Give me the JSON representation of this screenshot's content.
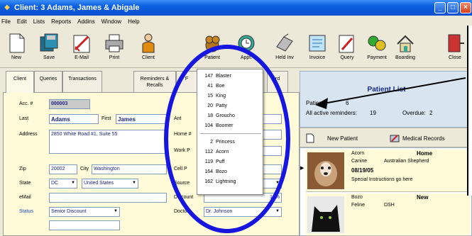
{
  "window": {
    "title": "Client: 3 Adams, James & Abigale",
    "menu": [
      "File",
      "Edit",
      "Lists",
      "Reports",
      "Addins",
      "Window",
      "Help"
    ]
  },
  "toolbar": {
    "items": [
      {
        "label": "New",
        "icon": "new-document-icon"
      },
      {
        "label": "Save",
        "icon": "save-icon"
      },
      {
        "label": "E-Mail",
        "icon": "email-icon"
      },
      {
        "label": "Print",
        "icon": "printer-icon"
      },
      {
        "label": "Client",
        "icon": "client-icon"
      },
      {
        "label": "Patient",
        "icon": "patient-icon"
      },
      {
        "label": "Appt.",
        "icon": "appointment-icon"
      },
      {
        "label": "Held Inv",
        "icon": "held-invoice-icon"
      },
      {
        "label": "Invoice",
        "icon": "invoice-icon"
      },
      {
        "label": "Query",
        "icon": "query-icon"
      },
      {
        "label": "Payment",
        "icon": "payment-icon"
      },
      {
        "label": "Boarding",
        "icon": "boarding-icon"
      },
      {
        "label": "Close",
        "icon": "close-icon"
      }
    ]
  },
  "tabs": [
    {
      "label": "Client"
    },
    {
      "label": "Queries"
    },
    {
      "label": "Transactions"
    },
    {
      "label": "Reminders & Recalls"
    },
    {
      "label": "F"
    },
    {
      "label": "rd"
    }
  ],
  "form": {
    "acct_label": "Acc. #",
    "acct_value": "000003",
    "last_label": "Last",
    "last_value": "Adams",
    "first_label": "First",
    "first_value": "James",
    "address_label": "Address",
    "address_value": "2850 White Road #1, Suite 55",
    "zip_label": "Zip",
    "zip_value": "20002",
    "city_label": "City",
    "city_value": "Washington",
    "state_label": "State",
    "state_value": "DC",
    "country_value": "United States",
    "email_label": "eMail",
    "status_label": "Status",
    "status_value": "Senior Discount",
    "right_labels": [
      "Ant",
      "Home #",
      "Work P",
      "Cell P",
      "Source",
      "Discount",
      "Doctor"
    ],
    "discount_value": "10%",
    "doctor_value": "Dr. Johnson"
  },
  "patient_list": {
    "title": "Patient List",
    "patients_label": "Patients:",
    "patients_count": "6",
    "reminders_label": "All active reminders:",
    "reminders_count": "19",
    "overdue_label": "Overdue:",
    "overdue_count": "2",
    "new_patient_label": "New Patient",
    "medical_records_label": "Medical Records",
    "pets": [
      {
        "name": "Acorn",
        "status": "Home",
        "species": "Canine",
        "breed": "Australian Shepherd",
        "date": "08/19/05",
        "note": "Special Instructions go here"
      },
      {
        "name": "Bozo",
        "status": "New",
        "species": "Feline",
        "breed": "DSH"
      }
    ]
  },
  "patient_menu": {
    "items": [
      {
        "num": "147",
        "name": "Blaster"
      },
      {
        "num": "41",
        "name": "Boe"
      },
      {
        "num": "15",
        "name": "King"
      },
      {
        "num": "20",
        "name": "Patty"
      },
      {
        "num": "18",
        "name": "Groucho"
      },
      {
        "num": "104",
        "name": "Boomer"
      },
      {
        "num": "2",
        "name": "Princess"
      },
      {
        "num": "112",
        "name": "Acorn"
      },
      {
        "num": "119",
        "name": "Puff"
      },
      {
        "num": "164",
        "name": "Bozo"
      },
      {
        "num": "162",
        "name": "Lightning"
      }
    ]
  },
  "colors": {
    "title_blue": "#0a5fe0",
    "form_yellow": "#fffbd8",
    "highlight_circle": "#1616e0"
  }
}
